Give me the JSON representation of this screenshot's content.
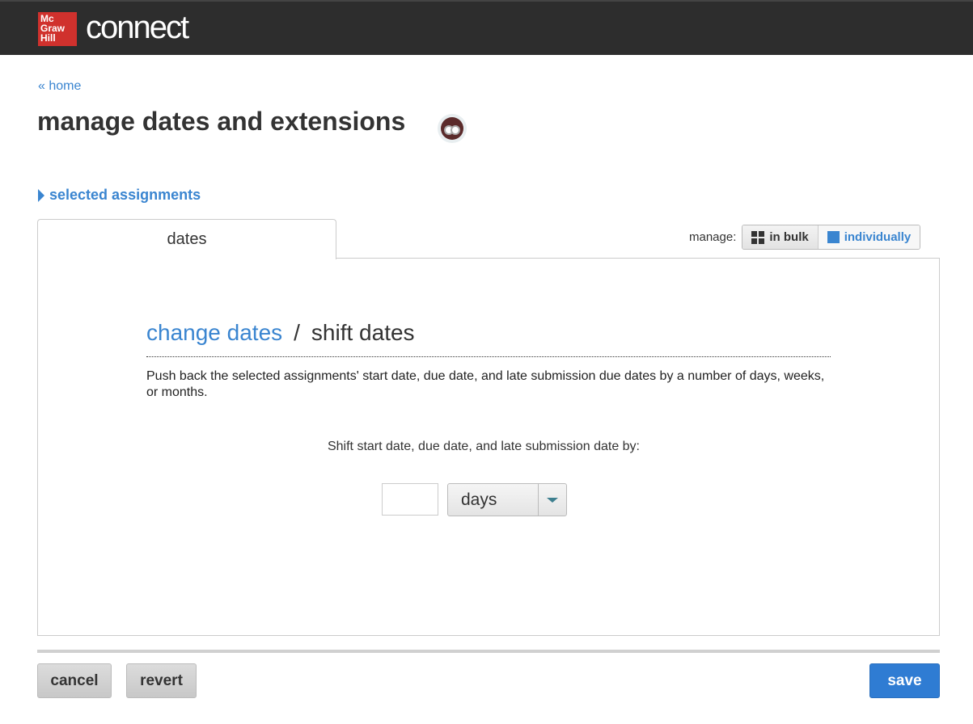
{
  "header": {
    "logo_text": "Mc Graw Hill",
    "brand": "connect"
  },
  "breadcrumb": {
    "home": "« home"
  },
  "page": {
    "title": "manage dates and extensions",
    "owl_icon": "owl-icon"
  },
  "selected_assignments": "selected assignments",
  "tabs": [
    {
      "label": "dates"
    }
  ],
  "manage": {
    "label": "manage:",
    "in_bulk": "in bulk",
    "individually": "individually",
    "selected": "in bulk"
  },
  "mode": {
    "change_dates": "change dates",
    "separator": "/",
    "shift_dates": "shift dates",
    "active": "shift dates"
  },
  "description": "Push back the selected assignments' start date, due date, and late submission due dates by a number of days, weeks, or months.",
  "shift": {
    "label": "Shift start date, due date, and late submission date by:",
    "amount": "",
    "unit": "days"
  },
  "footer": {
    "cancel": "cancel",
    "revert": "revert",
    "save": "save"
  },
  "colors": {
    "accent": "#3a85d0",
    "header": "#2d2d2d",
    "logo": "#d0312d",
    "save": "#2f7cd3"
  }
}
